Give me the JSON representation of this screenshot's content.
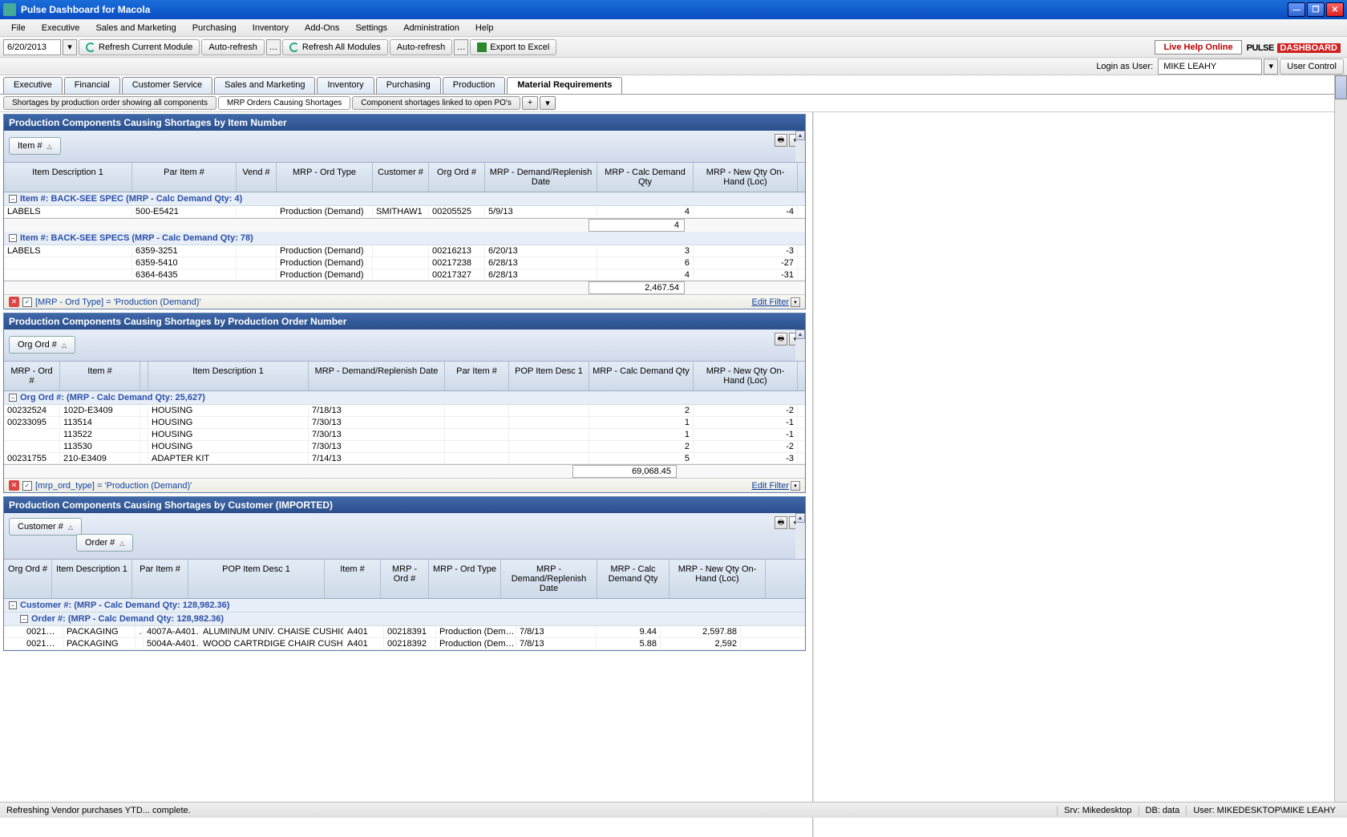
{
  "window": {
    "title": "Pulse Dashboard for Macola"
  },
  "menubar": [
    "File",
    "Executive",
    "Sales and Marketing",
    "Purchasing",
    "Inventory",
    "Add-Ons",
    "Settings",
    "Administration",
    "Help"
  ],
  "toolbar": {
    "date": "6/20/2013",
    "refresh_current": "Refresh Current Module",
    "auto_refresh": "Auto-refresh",
    "refresh_all": "Refresh All Modules",
    "export_excel": "Export to Excel",
    "live_help": "Live Help Online",
    "login_as": "Login as User:",
    "user": "MIKE LEAHY",
    "user_control": "User Control",
    "logo1": "PULSE",
    "logo2": "DASHBOARD"
  },
  "tabs_main": [
    "Executive",
    "Financial",
    "Customer Service",
    "Sales and Marketing",
    "Inventory",
    "Purchasing",
    "Production",
    "Material Requirements"
  ],
  "tabs_main_active": 7,
  "tabs_sub": [
    "Shortages by production order showing all components",
    "MRP Orders Causing Shortages",
    "Component shortages linked to open PO's"
  ],
  "tabs_sub_active": 1,
  "panel1": {
    "title": "Production Components Causing Shortages by Item Number",
    "groupby": "Item #",
    "cols": [
      "Item Description 1",
      "Par Item #",
      "Vend #",
      "MRP - Ord Type",
      "Customer #",
      "Org Ord #",
      "MRP - Demand/Replenish Date",
      "MRP - Calc Demand Qty",
      "MRP - New Qty On-Hand (Loc)"
    ],
    "widths": [
      160,
      130,
      50,
      120,
      70,
      70,
      140,
      120,
      130
    ],
    "groups": [
      {
        "label": "Item #: BACK-SEE SPEC   (MRP - Calc Demand Qty: 4)",
        "rows": [
          {
            "c": [
              "LABELS",
              "500-E5421",
              "",
              "Production (Demand)",
              "SMITHAW1",
              "00205525",
              "5/9/13",
              "4",
              "-4"
            ]
          }
        ],
        "sum": "4"
      },
      {
        "label": "Item #: BACK-SEE SPECS  (MRP - Calc Demand Qty: 78)",
        "rows": [
          {
            "c": [
              "LABELS",
              "6359-3251",
              "",
              "Production (Demand)",
              "",
              "00216213",
              "6/20/13",
              "3",
              "-3"
            ]
          },
          {
            "c": [
              "",
              "6359-5410",
              "",
              "Production (Demand)",
              "",
              "00217238",
              "6/28/13",
              "6",
              "-27"
            ]
          },
          {
            "c": [
              "",
              "6364-6435",
              "",
              "Production (Demand)",
              "",
              "00217327",
              "6/28/13",
              "4",
              "-31"
            ]
          }
        ]
      }
    ],
    "total": "2,467.54",
    "filter": "[MRP - Ord Type] = 'Production (Demand)'",
    "edit": "Edit Filter"
  },
  "panel2": {
    "title": "Production Components Causing Shortages by Production Order Number",
    "groupby": "Org Ord #",
    "cols": [
      "MRP - Ord #",
      "Item #",
      "",
      "Item Description 1",
      "MRP - Demand/Replenish Date",
      "Par Item #",
      "POP Item Desc 1",
      "MRP - Calc Demand Qty",
      "MRP - New Qty On-Hand (Loc)"
    ],
    "widths": [
      70,
      100,
      10,
      200,
      170,
      80,
      100,
      130,
      130
    ],
    "groups": [
      {
        "label": "Org Ord #:  (MRP - Calc Demand Qty: 25,627)",
        "rows": [
          {
            "c": [
              "00232524",
              "102D-E3409",
              "",
              "HOUSING",
              "7/18/13",
              "",
              "",
              "2",
              "-2"
            ]
          },
          {
            "c": [
              "00233095",
              "113514",
              "",
              "HOUSING",
              "7/30/13",
              "",
              "",
              "1",
              "-1"
            ]
          },
          {
            "c": [
              "",
              "113522",
              "",
              "HOUSING",
              "7/30/13",
              "",
              "",
              "1",
              "-1"
            ]
          },
          {
            "c": [
              "",
              "113530",
              "",
              "HOUSING",
              "7/30/13",
              "",
              "",
              "2",
              "-2"
            ]
          },
          {
            "c": [
              "00231755",
              "210-E3409",
              "",
              "ADAPTER KIT",
              "7/14/13",
              "",
              "",
              "5",
              "-3"
            ]
          }
        ]
      }
    ],
    "total": "69,068.45",
    "filter": "[mrp_ord_type] = 'Production (Demand)'",
    "edit": "Edit Filter"
  },
  "panel3": {
    "title": "Production Components Causing Shortages by Customer (IMPORTED)",
    "groupby1": "Customer #",
    "groupby2": "Order #",
    "cols": [
      "Org Ord #",
      "Item Description 1",
      "Par Item #",
      "POP Item Desc 1",
      "Item #",
      "MRP - Ord #",
      "MRP - Ord Type",
      "MRP - Demand/Replenish Date",
      "MRP - Calc Demand Qty",
      "MRP - New Qty On-Hand (Loc)"
    ],
    "widths": [
      60,
      100,
      70,
      170,
      70,
      60,
      90,
      120,
      90,
      120
    ],
    "group1": "Customer #:  (MRP - Calc Demand Qty: 128,982.36)",
    "group2": "Order #:  (MRP - Calc Demand Qty: 128,982.36)",
    "rows": [
      {
        "c": [
          "0021…",
          "PACKAGING",
          "…",
          "4007A-A401…",
          "ALUMINUM UNIV. CHAISE CUSHIO…",
          "A401",
          "00218391",
          "Production (Dem…",
          "7/8/13",
          "9.44",
          "2,597.88"
        ]
      },
      {
        "c": [
          "0021…",
          "PACKAGING",
          "",
          "5004A-A401…",
          "WOOD CARTRDIGE CHAIR CUSHI…",
          "A401",
          "00218392",
          "Production (Dem…",
          "7/8/13",
          "5.88",
          "2,592"
        ]
      }
    ]
  },
  "statusbar": {
    "msg": "Refreshing Vendor purchases YTD... complete.",
    "srv": "Srv: Mikedesktop",
    "db": "DB: data",
    "user": "User: MIKEDESKTOP\\MIKE LEAHY"
  }
}
